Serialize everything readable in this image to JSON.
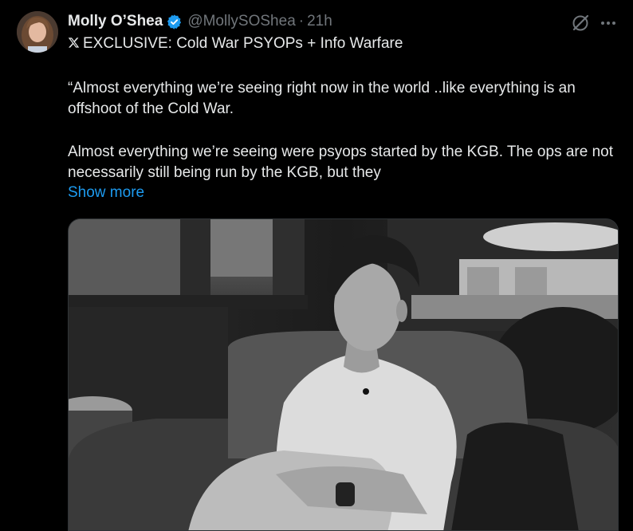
{
  "tweet": {
    "author_name": "Molly O’Shea",
    "handle": "@MollySOShea",
    "separator": "·",
    "time": "21h",
    "subline_icon": "x-logo-icon",
    "subline_text": "EXCLUSIVE: Cold War PSYOPs + Info Warfare",
    "paragraph_1": "“Almost everything we’re seeing right now in the world ..like everything is an offshoot of the Cold War.",
    "paragraph_2": "Almost everything we’re seeing were psyops started by the KGB. The ops are not necessarily still being run by the KGB, but they",
    "show_more": "Show more"
  },
  "icons": {
    "verified": "verified-badge-icon",
    "grok": "grok-icon",
    "more": "more-options-icon"
  },
  "colors": {
    "background": "#000000",
    "text_primary": "#e7e9ea",
    "text_secondary": "#71767b",
    "link": "#1d9bf0",
    "verified": "#1d9bf0"
  }
}
